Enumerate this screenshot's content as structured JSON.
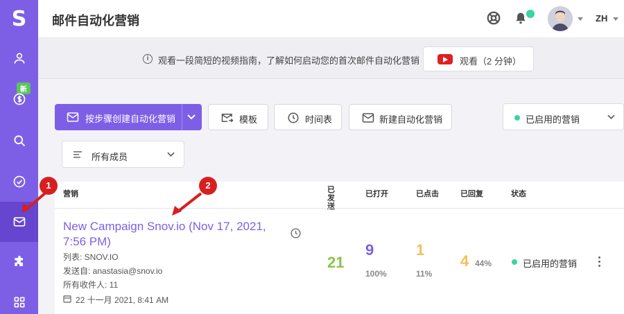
{
  "app": {
    "logo_letter": "S",
    "page_title": "邮件自动化营销",
    "new_badge": "新",
    "lang": "ZH"
  },
  "sidebar": {
    "items": [
      {
        "name": "prospects",
        "icon": "user-icon"
      },
      {
        "name": "billing",
        "icon": "dollar-icon"
      },
      {
        "name": "search",
        "icon": "search-icon"
      },
      {
        "name": "verifier",
        "icon": "check-circle-icon"
      },
      {
        "name": "campaigns",
        "icon": "mail-icon",
        "active": true
      },
      {
        "name": "integrations",
        "icon": "puzzle-icon"
      },
      {
        "name": "apps",
        "icon": "grid-icon"
      }
    ]
  },
  "infobar": {
    "text": "观看一段简短的视频指南，了解如何启动您的首次邮件自动化营销",
    "watch_label": "观看（2 分钟）"
  },
  "toolbar": {
    "create_label": "按步骤创建自动化营销",
    "template_label": "模板",
    "schedule_label": "时间表",
    "new_label": "新建自动化营销",
    "status_filter": "已启用的营销",
    "member_filter": "所有成员"
  },
  "table": {
    "headers": {
      "campaign": "营销",
      "sent": "已发送",
      "opened": "已打开",
      "clicked": "已点击",
      "replied": "已回复",
      "status": "状态"
    },
    "row": {
      "title": "New Campaign Snov.io (Nov 17, 2021, 7:56 PM)",
      "list": "列表: SNOV.IO",
      "from": "发送自: anastasia@snov.io",
      "recipients": "所有收件人: 11",
      "date": "22 十一月 2021, 8:41 AM",
      "sent": "21",
      "opened": "9",
      "opened_pct": "100%",
      "clicked": "1",
      "clicked_pct": "11%",
      "replied": "4",
      "replied_pct": "44%",
      "status": "已启用的营销"
    }
  },
  "callouts": {
    "one": "1",
    "two": "2"
  },
  "colors": {
    "accent": "#7d5fe6",
    "green": "#8bc34a",
    "yellow": "#f3c15a",
    "red": "#d81f1f",
    "status_dot": "#3ad4a0"
  }
}
